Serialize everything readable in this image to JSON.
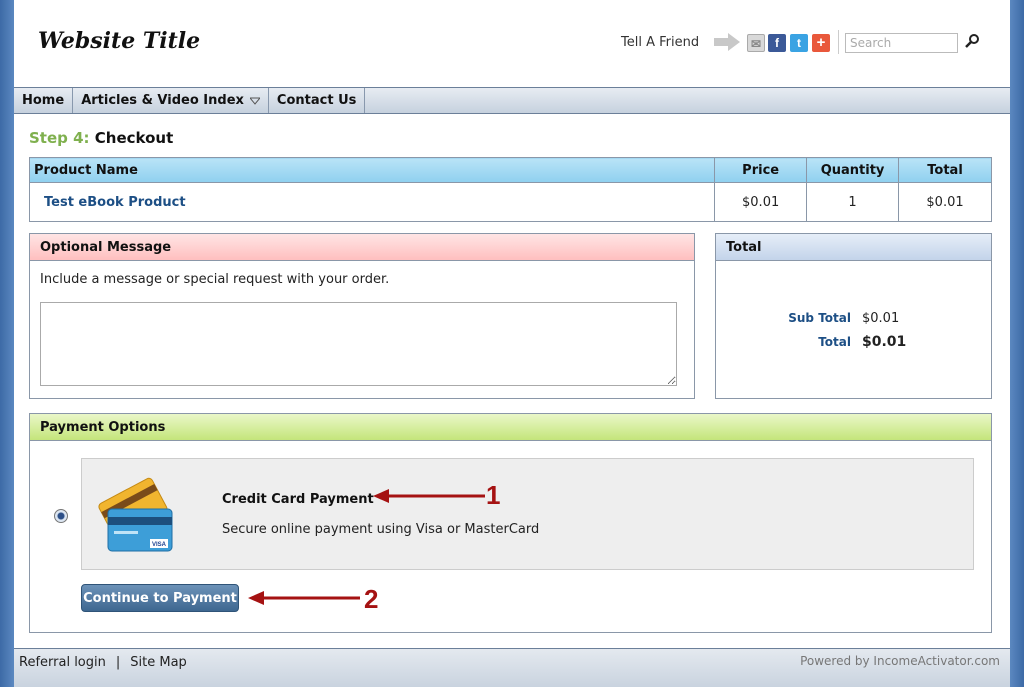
{
  "header": {
    "site_title": "Website Title",
    "tell_friend": "Tell A Friend",
    "search_placeholder": "Search"
  },
  "nav": {
    "items": [
      "Home",
      "Articles & Video Index",
      "Contact Us"
    ]
  },
  "step": {
    "number_label": "Step 4:",
    "name": "Checkout"
  },
  "products": {
    "columns": [
      "Product Name",
      "Price",
      "Quantity",
      "Total"
    ],
    "rows": [
      {
        "name": "Test eBook Product",
        "price": "$0.01",
        "quantity": "1",
        "total": "$0.01"
      }
    ]
  },
  "message": {
    "title": "Optional Message",
    "instructions": "Include a message or special request with your order.",
    "value": ""
  },
  "totals": {
    "title": "Total",
    "sub_total_label": "Sub Total",
    "sub_total_value": "$0.01",
    "total_label": "Total",
    "total_value": "$0.01"
  },
  "payment": {
    "title": "Payment Options",
    "option_title": "Credit Card Payment",
    "option_desc": "Secure online payment using Visa or MasterCard",
    "continue_label": "Continue to Payment",
    "card_brand": "VISA"
  },
  "annotations": {
    "one": "1",
    "two": "2",
    "color": "#a51212"
  },
  "footer": {
    "referral": "Referral login",
    "separator": "|",
    "sitemap": "Site Map",
    "powered": "Powered by IncomeActivator.com"
  },
  "colors": {
    "step_accent": "#7fb04e",
    "link": "#1d4f85",
    "button": "#4a729a"
  }
}
